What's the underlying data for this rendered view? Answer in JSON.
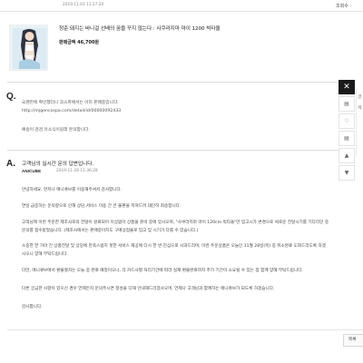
{
  "header": {
    "date": "2019.11.03 11:27:20",
    "link": "조회수 :"
  },
  "product": {
    "title": "청춘 돼지는 바니걸 선배의 꿈을 꾸지 않는다 : 사쿠라지마 마이 1200 빅타올",
    "price": "판매금액 46,700원"
  },
  "question": {
    "mark": "Q.",
    "lines": [
      "오랜만에 확인했더니 코스파에서는 이미 판매중입니다.",
      "http://mjgencospa.com/detail/id/00000092433",
      "",
      "예송이 검검 유소식이길래 문의합니다."
    ]
  },
  "answer": {
    "mark": "A.",
    "title": "고객님의 실시간 문의 답변입니다.",
    "brand": "ANICUBE",
    "date": "2019-11-28 11:36:28",
    "lines": [
      "안녕하세요. 먼저나 애니큐브를 이용해주셔서 감사합니다.",
      "",
      "연일 급증하는 문의량으로 인해 상담 서비스 이용 간 큰 불편을 끼쳐드려 대단히 죄송합니다.",
      "",
      "고객님께 이번 주문한 제조사로의 전달이 원료되어 이상없이 상품을 준비 중에 있사오며, \"사쿠라지마 마이 120cm 빅타올\"만 입고시가 변경으로 써로운 전달시기를 기다리던 중",
      "문의를 접수받았습니다. (제조사에서는 판매중이지도 구매상점물로 입고 및 시기가 다를 수 있습니다.)",
      "",
      "소중한 한 가마 간 상품전달 및 상당에 만족스럽지 못한 서비스 제공에 다시 한 번 진심으로 사과드리며, 이번 주문상품은 오늘인 11월 28일(목) 중 취소완료 도와드리도록 하겠",
      "사오니 양해 부탁드립니다.",
      "",
      "다만, 애니큐브에서 환불절차는 오늘 중 완료 예정이오나, 각 카드사별 처리기간에 따라 실제 환불완료까지 추가 기간이 소요될 수 있는 점 함께 양해 부탁드립니다.",
      "",
      "다른 궁금한 사항이 있으신 경우 언제든지 문의주시면 정성을 다해 안내해드리겠사오며, 언제나 고객님과 함께하는 애니큐브가 되도록 하겠습니다.",
      "",
      "감사합니다."
    ]
  },
  "rail": {
    "close": "✕",
    "buttons": [
      "▤",
      "♡",
      "▤",
      "▲",
      "▼"
    ],
    "strip": [
      "결",
      "제"
    ]
  },
  "footer": {
    "list_button": "목록"
  }
}
